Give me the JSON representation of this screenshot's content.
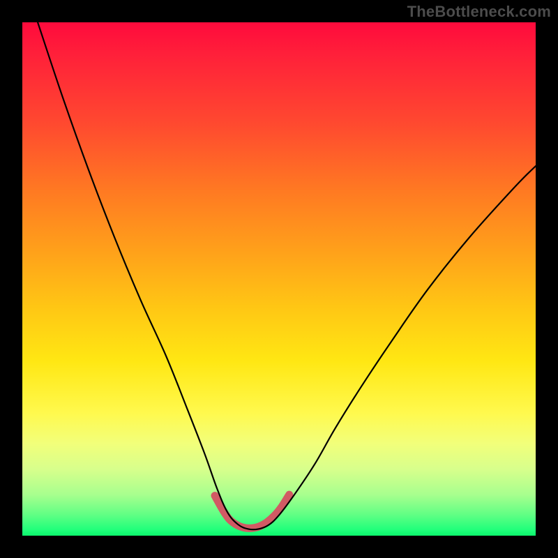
{
  "watermark": "TheBottleneck.com",
  "chart_data": {
    "type": "line",
    "title": "",
    "xlabel": "",
    "ylabel": "",
    "xlim": [
      0,
      100
    ],
    "ylim": [
      0,
      100
    ],
    "grid": false,
    "legend": false,
    "series": [
      {
        "name": "bottleneck-curve",
        "x": [
          3,
          8,
          13,
          18,
          23,
          28,
          32,
          35.5,
          38,
          40,
          42,
          44,
          46,
          48,
          50,
          53,
          57,
          61,
          66,
          72,
          79,
          87,
          96,
          100
        ],
        "y": [
          100,
          85,
          71,
          58,
          46,
          35,
          25,
          16,
          9,
          4.5,
          2.2,
          1.3,
          1.3,
          2.1,
          4,
          8,
          14,
          21,
          29,
          38,
          48,
          58,
          68,
          72
        ],
        "color": "#000000",
        "width": 2.2
      },
      {
        "name": "valley-highlight",
        "x": [
          37.5,
          39.5,
          41,
          43,
          45,
          47,
          49,
          50.5,
          52
        ],
        "y": [
          7.8,
          4.3,
          2.6,
          1.6,
          1.5,
          2.2,
          3.8,
          5.6,
          8.0
        ],
        "color": "#d15a64",
        "width": 11
      }
    ],
    "background_gradient": {
      "top": "#ff0a3c",
      "mid1": "#ffa21a",
      "mid2": "#fff94d",
      "bottom": "#0cf56c"
    }
  }
}
